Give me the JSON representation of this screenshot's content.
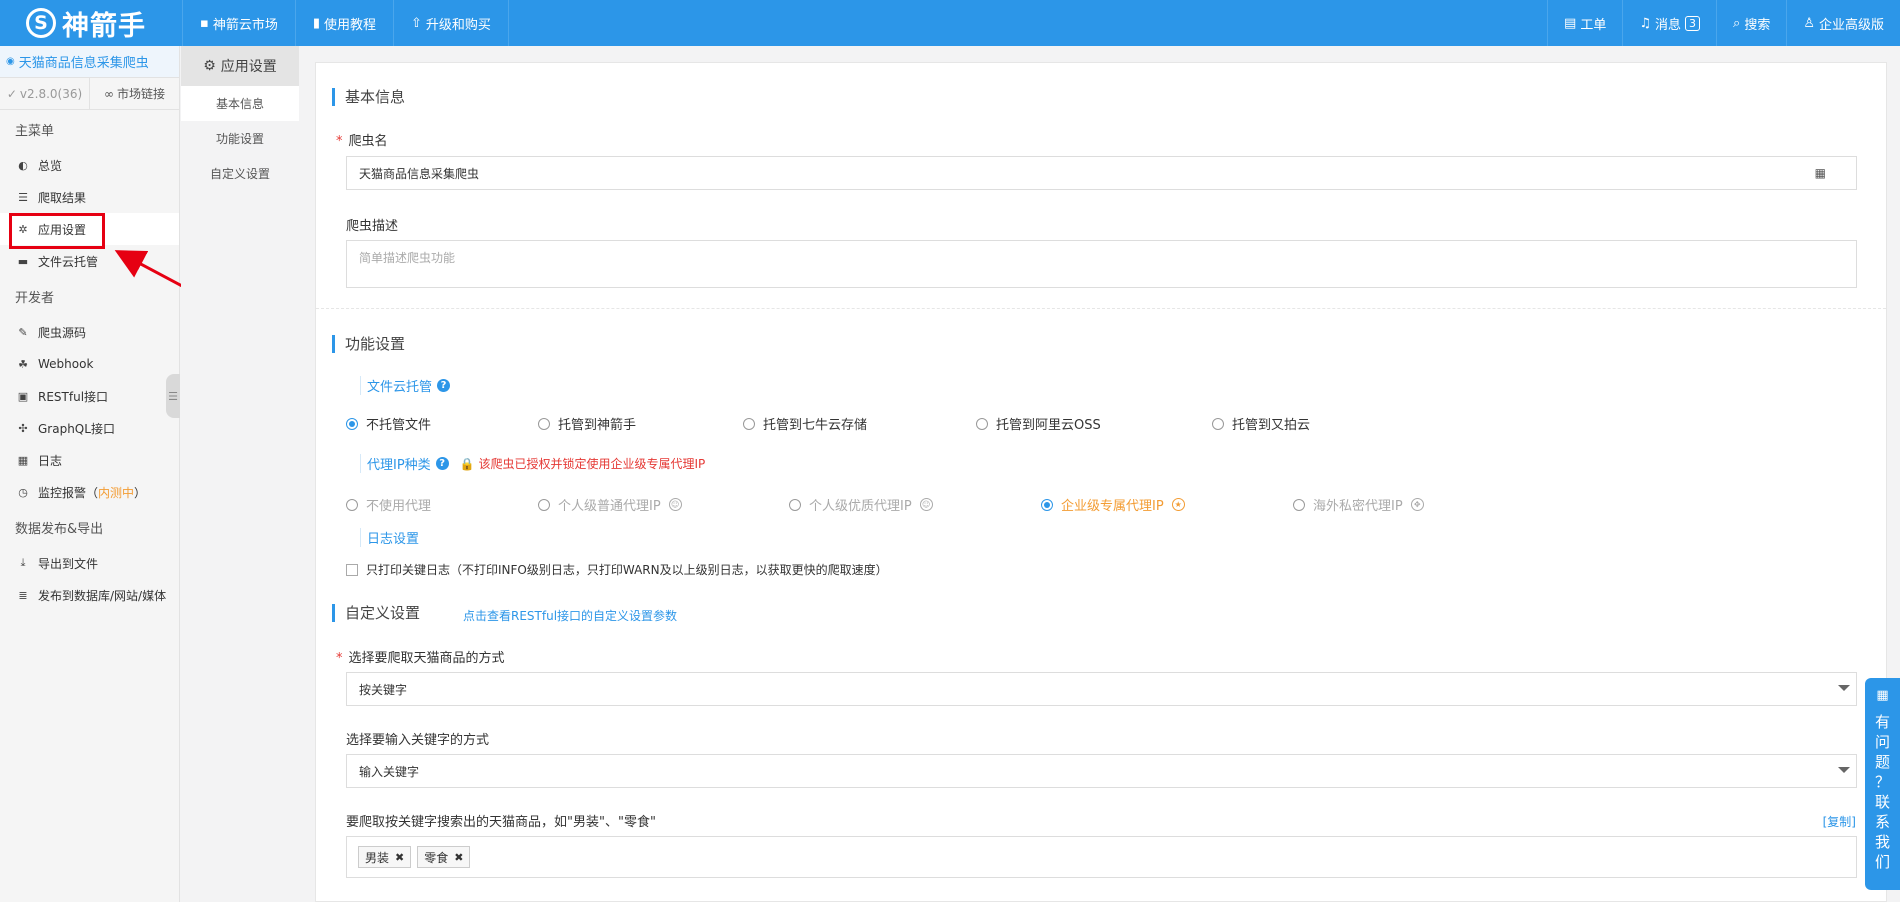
{
  "topbar": {
    "logo_mark": "S",
    "logo_text": "神箭手",
    "nav": [
      {
        "icon": "▪",
        "label": "神箭云市场"
      },
      {
        "icon": "▮",
        "label": "使用教程"
      },
      {
        "icon": "⇧",
        "label": "升级和购买"
      }
    ],
    "right": [
      {
        "icon": "▤",
        "label": "工单"
      },
      {
        "icon": "♫",
        "label": "消息",
        "badge": "3"
      },
      {
        "icon": "⌕",
        "label": "搜索"
      },
      {
        "icon": "♙",
        "label": "企业高级版"
      }
    ]
  },
  "sidebar": {
    "app_title": "天猫商品信息采集爬虫",
    "version": "v2.8.0(36)",
    "market_link": "市场链接",
    "groups": [
      {
        "title": "主菜单",
        "items": [
          {
            "icon": "◐",
            "label": "总览"
          },
          {
            "icon": "☰",
            "label": "爬取结果"
          },
          {
            "icon": "✲",
            "label": "应用设置"
          },
          {
            "icon": "▬",
            "label": "文件云托管"
          }
        ]
      },
      {
        "title": "开发者",
        "items": [
          {
            "icon": "✎",
            "label": "爬虫源码"
          },
          {
            "icon": "☘",
            "label": "Webhook"
          },
          {
            "icon": "▣",
            "label": "RESTful接口"
          },
          {
            "icon": "✣",
            "label": "GraphQL接口"
          },
          {
            "icon": "▦",
            "label": "日志"
          },
          {
            "icon": "◷",
            "label": "监控报警",
            "suffix_open": "（",
            "suffix": "内测中",
            "suffix_close": "）"
          }
        ]
      },
      {
        "title": "数据发布&导出",
        "items": [
          {
            "icon": "⤓",
            "label": "导出到文件"
          },
          {
            "icon": "≣",
            "label": "发布到数据库/网站/媒体"
          }
        ]
      }
    ]
  },
  "subnav": {
    "header": "应用设置",
    "items": [
      "基本信息",
      "功能设置",
      "自定义设置"
    ]
  },
  "basic": {
    "title": "基本信息",
    "name_label": "爬虫名",
    "name_value": "天猫商品信息采集爬虫",
    "desc_label": "爬虫描述",
    "desc_placeholder": "简单描述爬虫功能"
  },
  "features": {
    "title": "功能设置",
    "hosting_label": "文件云托管",
    "hosting_options": [
      "不托管文件",
      "托管到神箭手",
      "托管到七牛云存储",
      "托管到阿里云OSS",
      "托管到又拍云"
    ],
    "proxy_label": "代理IP种类",
    "proxy_note": "该爬虫已授权并锁定使用企业级专属代理IP",
    "proxy_options": [
      "不使用代理",
      "个人级普通代理IP",
      "个人级优质代理IP",
      "企业级专属代理IP",
      "海外私密代理IP"
    ],
    "log_label": "日志设置",
    "log_checkbox": "只打印关键日志（不打印INFO级别日志，只打印WARN及以上级别日志，以获取更快的爬取速度）"
  },
  "custom": {
    "title": "自定义设置",
    "link": "点击查看RESTful接口的自定义设置参数",
    "method_label": "选择要爬取天猫商品的方式",
    "method_value": "按关键字",
    "input_label": "选择要输入关键字的方式",
    "input_value": "输入关键字",
    "keywords_label": "要爬取按关键字搜索出的天猫商品，如\"男装\"、\"零食\"",
    "copy_link": "[复制]",
    "tags": [
      "男装",
      "零食"
    ]
  },
  "feedback": {
    "chars": [
      "有",
      "问",
      "题",
      "？",
      "联",
      "系",
      "我",
      "们"
    ]
  },
  "colors": {
    "accent": "#2c96e8",
    "highlight": "#e60012",
    "warning": "#f39c33"
  }
}
